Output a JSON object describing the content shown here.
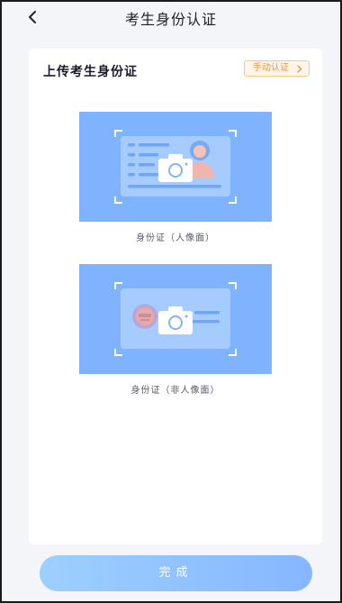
{
  "header": {
    "title": "考生身份认证",
    "back_icon": "chevron-left-icon"
  },
  "card": {
    "title": "上传考生身份证",
    "manual_button_label": "手动认证",
    "manual_button_icon": "chevron-right-icon"
  },
  "id_front": {
    "caption": "身份证（人像面）",
    "icon": "camera-icon"
  },
  "id_back": {
    "caption": "身份证（非人像面）",
    "icon": "camera-icon"
  },
  "footer": {
    "complete_label": "完成"
  },
  "colors": {
    "accent_blue": "#7fb3fd",
    "manual_orange": "#e8933a",
    "button_gradient_start": "#9dd0ff",
    "button_gradient_end": "#86b6ff"
  }
}
